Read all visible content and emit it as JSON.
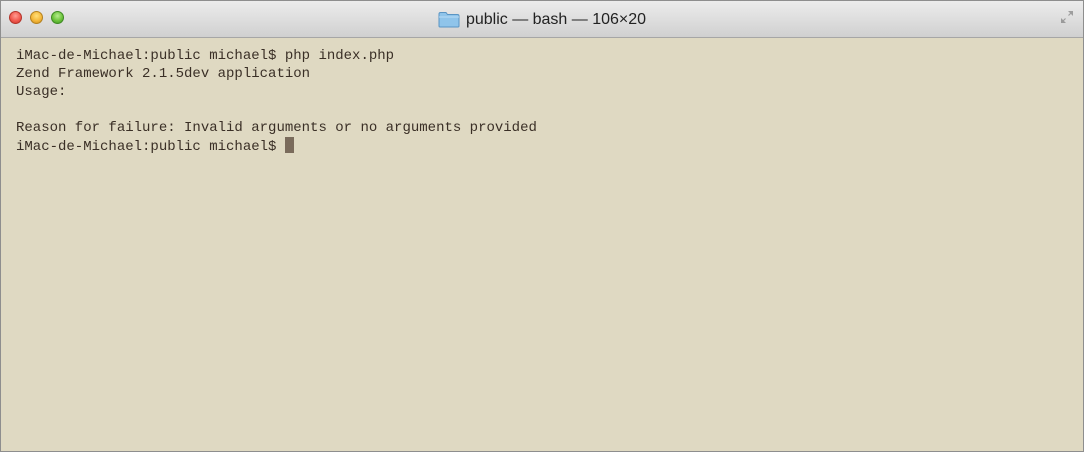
{
  "window": {
    "title": "public — bash — 106×20"
  },
  "terminal": {
    "lines": [
      "iMac-de-Michael:public michael$ php index.php",
      "Zend Framework 2.1.5dev application",
      "Usage:",
      "",
      "Reason for failure: Invalid arguments or no arguments provided"
    ],
    "prompt": "iMac-de-Michael:public michael$ "
  },
  "colors": {
    "background": "#dfd9c2",
    "text": "#3a2f26",
    "cursor": "#7a6b5b"
  }
}
